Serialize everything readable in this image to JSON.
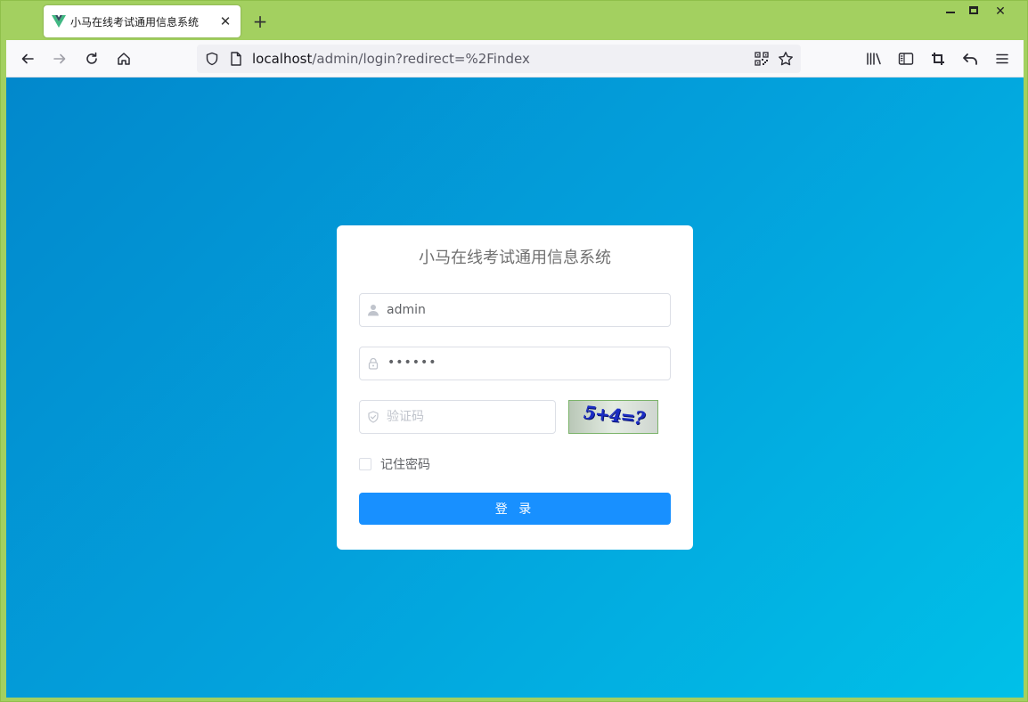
{
  "browser": {
    "tab": {
      "title": "小马在线考试通用信息系统",
      "favicon": "vue-logo-icon"
    },
    "url": {
      "host": "localhost",
      "path": "/admin/login?redirect=%2Findex"
    }
  },
  "login": {
    "title": "小马在线考试通用信息系统",
    "username": {
      "value": "admin",
      "icon": "user-icon"
    },
    "password": {
      "masked": "••••••",
      "icon": "lock-icon"
    },
    "code": {
      "placeholder": "验证码",
      "icon": "shield-icon"
    },
    "captcha_text": "5+4=?",
    "remember_label": "记住密码",
    "submit_label": "登 录"
  },
  "colors": {
    "frame": "#a3d060",
    "page_gradient_start": "#0288cc",
    "page_gradient_end": "#00c0e8",
    "primary_button": "#1890ff"
  }
}
